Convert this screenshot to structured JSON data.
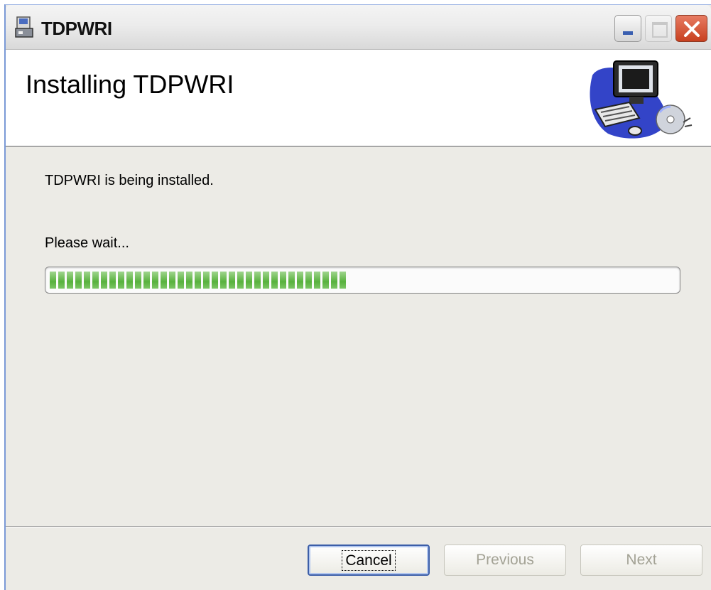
{
  "window": {
    "title": "TDPWRI",
    "accent_color": "#3c5ea8",
    "close_color": "#d6532f"
  },
  "header": {
    "heading": "Installing TDPWRI",
    "art_icon": "computer-cd-clipart-icon"
  },
  "body": {
    "status_text": "TDPWRI is being installed.",
    "wait_text": "Please wait...",
    "progress_fraction": 0.48,
    "progress_color": "#6cc253"
  },
  "footer": {
    "cancel_label": "Cancel",
    "previous_label": "Previous",
    "next_label": "Next"
  }
}
